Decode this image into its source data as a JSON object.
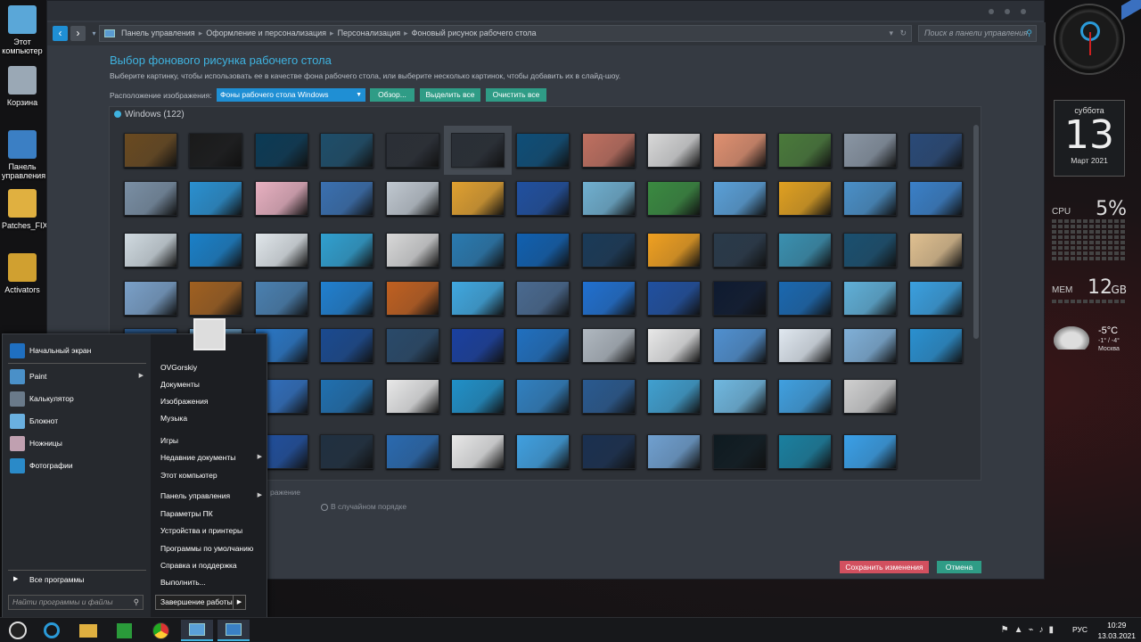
{
  "desktop": {
    "icons": [
      {
        "label": "Этот компьютер",
        "color": "#5aa7d8"
      },
      {
        "label": "Корзина",
        "color": "#9aa8b5"
      },
      {
        "label": "Панель управления",
        "color": "#3b7fc4"
      },
      {
        "label": "Patches_FIX",
        "color": "#e0b040"
      },
      {
        "label": "Activators",
        "color": "#d0a030"
      }
    ]
  },
  "window": {
    "breadcrumb": [
      "Панель управления",
      "Оформление и персонализация",
      "Персонализация",
      "Фоновый рисунок рабочего стола"
    ],
    "search_placeholder": "Поиск в панели управления",
    "heading": "Выбор фонового рисунка рабочего стола",
    "subtext": "Выберите картинку, чтобы использовать ее в качестве фона рабочего стола, или выберите несколько картинок, чтобы добавить их в слайд-шоу.",
    "location_label": "Расположение изображения:",
    "location_value": "Фоны рабочего стола Windows",
    "browse_button": "Обзор...",
    "select_all_button": "Выделить все",
    "clear_all_button": "Очистить все",
    "gallery_title": "Windows (122)",
    "position_partial": "ражение",
    "shuffle_label": "В случайном порядке",
    "save_button": "Сохранить изменения",
    "cancel_button": "Отмена",
    "thumb_colors": [
      [
        "#6a4a20",
        "#1a1a1a",
        "#0b3a55",
        "#1e4e6a",
        "#2b2f36",
        "#2a2f36",
        "#0e4e78",
        "#c07060",
        "#d8d8d8",
        "#e09070",
        "#4a7a3a",
        "#8a96a4",
        "#2a4a78"
      ],
      [
        "#7a8fa4",
        "#2a90d0",
        "#e8b0c0",
        "#3a70b0",
        "#c0c8d0",
        "#e0a030",
        "#2050a0",
        "#70b0d0",
        "#3a8a40",
        "#5aa0d8",
        "#e0a020",
        "#4a90c8",
        "#3a80c8"
      ],
      [
        "#d0dae0",
        "#1a80c8",
        "#e0e6ea",
        "#30a0d0",
        "#d8d8d8",
        "#2a7ab0",
        "#1060b0",
        "#1a3a58",
        "#f0a020",
        "#2a3a4a",
        "#3a90b0",
        "#1a5070",
        "#e0c090"
      ],
      [
        "#7aa0c8",
        "#a06020",
        "#4a80b0",
        "#2080d0",
        "#c06020",
        "#40a8e0",
        "#4a6a90",
        "#2070d0",
        "#2050a0",
        "#0e1a30",
        "#1a68b0",
        "#60b0d8",
        "#3aa0e0"
      ],
      [
        "#2a5a90",
        "#6aa0c8",
        "#2a78c8",
        "#1a4a90",
        "#2a4a6a",
        "#1a40a0",
        "#2070c0",
        "#b0b8c0",
        "#e8e8e8",
        "#5090d0",
        "#e0e8f0",
        "#80b0d8",
        "#2a90d0"
      ],
      [
        "#1a3a68",
        "#101a2a",
        "#3070c0",
        "#2070b0",
        "#e8e8e8",
        "#2090c8",
        "#3080c0",
        "#2a5a90",
        "#40a0d0",
        "#70b8e0",
        "#40a0e0",
        "#d0d0d0"
      ],
      [
        "#1a3050",
        "#2a6a30",
        "#2050a0",
        "#203040",
        "#2a6ab0",
        "#e8e8e8",
        "#40a0e0",
        "#1a3050",
        "#70a0d0",
        "#0e1a20",
        "#1a80a0",
        "#3aa0e8"
      ]
    ]
  },
  "start_menu": {
    "start_screen": "Начальный экран",
    "pinned": [
      {
        "label": "Paint",
        "color": "#4a90c8"
      },
      {
        "label": "Калькулятор",
        "color": "#6a7a8a"
      },
      {
        "label": "Блокнот",
        "color": "#6ab0e0"
      },
      {
        "label": "Ножницы",
        "color": "#c0a0b0"
      },
      {
        "label": "Фотографии",
        "color": "#2a8ac8"
      }
    ],
    "all_programs": "Все программы",
    "search_placeholder": "Найти программы и файлы",
    "right": [
      "OVGorskiy",
      "Документы",
      "Изображения",
      "Музыка",
      "Игры",
      "Недавние документы",
      "Этот компьютер",
      "Панель управления",
      "Параметры ПК",
      "Устройства и принтеры",
      "Программы по умолчанию",
      "Справка и поддержка",
      "Выполнить..."
    ],
    "shutdown": "Завершение работы"
  },
  "gadgets": {
    "calendar": {
      "weekday": "суббота",
      "day": "13",
      "month": "Март 2021"
    },
    "cpu": {
      "label": "CPU",
      "value": "5%"
    },
    "mem": {
      "label": "MEM",
      "value": "12",
      "unit": "GB"
    },
    "weather": {
      "temp": "-5°C",
      "range": "-1° / -4°",
      "city": "Москва"
    }
  },
  "taskbar": {
    "lang": "РУС",
    "time": "10:29",
    "date": "13.03.2021"
  }
}
